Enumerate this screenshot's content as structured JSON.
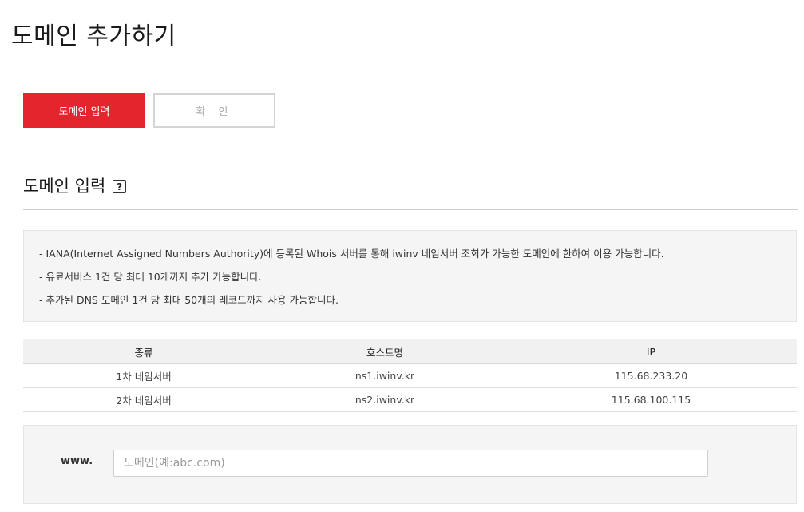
{
  "page": {
    "title": "도메인 추가하기"
  },
  "steps": {
    "input_label": "도메인 입력",
    "confirm_label": "확 인"
  },
  "section": {
    "title": "도메인 입력",
    "help_symbol": "?"
  },
  "notices": [
    "- IANA(Internet Assigned Numbers Authority)에 등록된 Whois 서버를 통해 iwinv 네임서버 조회가 가능한 도메인에 한하여 이용 가능합니다.",
    "- 유료서비스 1건 당 최대 10개까지 추가 가능합니다.",
    "- 추가된 DNS 도메인 1건 당 최대 50개의 레코드까지 사용 가능합니다."
  ],
  "nameserver_table": {
    "headers": [
      "종류",
      "호스트명",
      "IP"
    ],
    "rows": [
      [
        "1차 네임서버",
        "ns1.iwinv.kr",
        "115.68.233.20"
      ],
      [
        "2차 네임서버",
        "ns2.iwinv.kr",
        "115.68.100.115"
      ]
    ]
  },
  "domain_form": {
    "prefix_label": "www.",
    "placeholder": "도메인(예:abc.com)",
    "value": ""
  },
  "colors": {
    "accent": "#e3262e",
    "panel_bg": "#f5f5f5"
  }
}
